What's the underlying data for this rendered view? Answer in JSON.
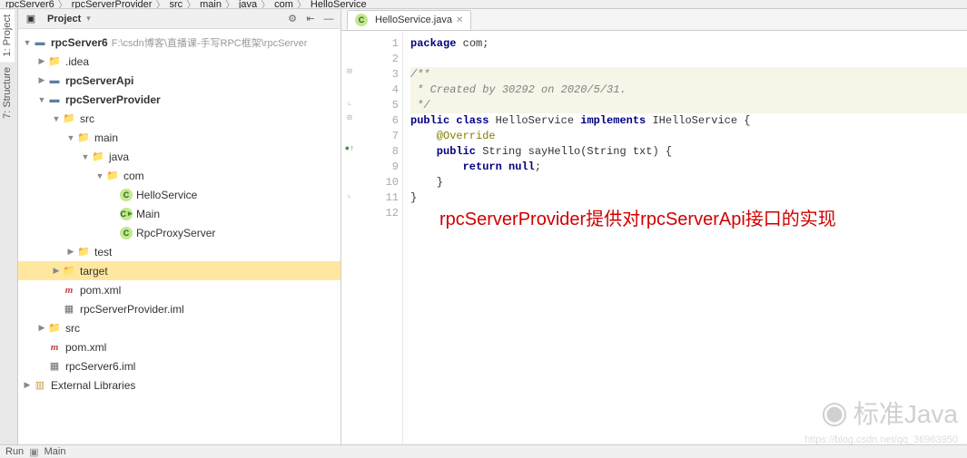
{
  "breadcrumb": [
    "rpcServer6",
    "rpcServerProvider",
    "src",
    "main",
    "java",
    "com",
    "HelloService"
  ],
  "left_tabs": {
    "project": "1: Project",
    "structure": "7: Structure"
  },
  "project_panel": {
    "title": "Project",
    "tools": {
      "settings": "⚙",
      "collapse": "⇤",
      "hide": "—"
    }
  },
  "tree": {
    "root": {
      "name": "rpcServer6",
      "path": "F:\\csdn博客\\直播课-手写RPC框架\\rpcServer"
    },
    "idea": ".idea",
    "api": "rpcServerApi",
    "provider": "rpcServerProvider",
    "src": "src",
    "main": "main",
    "java": "java",
    "com": "com",
    "hello": "HelloService",
    "main_class": "Main",
    "proxy": "RpcProxyServer",
    "test": "test",
    "target": "target",
    "pom": "pom.xml",
    "iml_provider": "rpcServerProvider.iml",
    "src2": "src",
    "pom2": "pom.xml",
    "iml_root": "rpcServer6.iml",
    "libs": "External Libraries"
  },
  "editor": {
    "tab": {
      "label": "HelloService.java"
    },
    "lines": {
      "l1_a": "package",
      "l1_b": " com;",
      "l3": "/**",
      "l4": " * Created by 30292 on 2020/5/31.",
      "l5": " */",
      "l6_a": "public class",
      "l6_b": " HelloService ",
      "l6_c": "implements",
      "l6_d": " IHelloService {",
      "l7": "    @Override",
      "l8_a": "    public",
      "l8_b": " String sayHello(String txt) {",
      "l9_a": "        return null",
      "l9_b": ";",
      "l10": "    }",
      "l11": "}"
    },
    "line_numbers": [
      "1",
      "2",
      "3",
      "4",
      "5",
      "6",
      "7",
      "8",
      "9",
      "10",
      "11",
      "12"
    ]
  },
  "annotation": "rpcServerProvider提供对rpcServerApi接口的实现",
  "watermark": {
    "text": "标准Java",
    "url": "https://blog.csdn.net/qq_36963950"
  },
  "bottom": {
    "run": "Run",
    "main": "Main"
  }
}
